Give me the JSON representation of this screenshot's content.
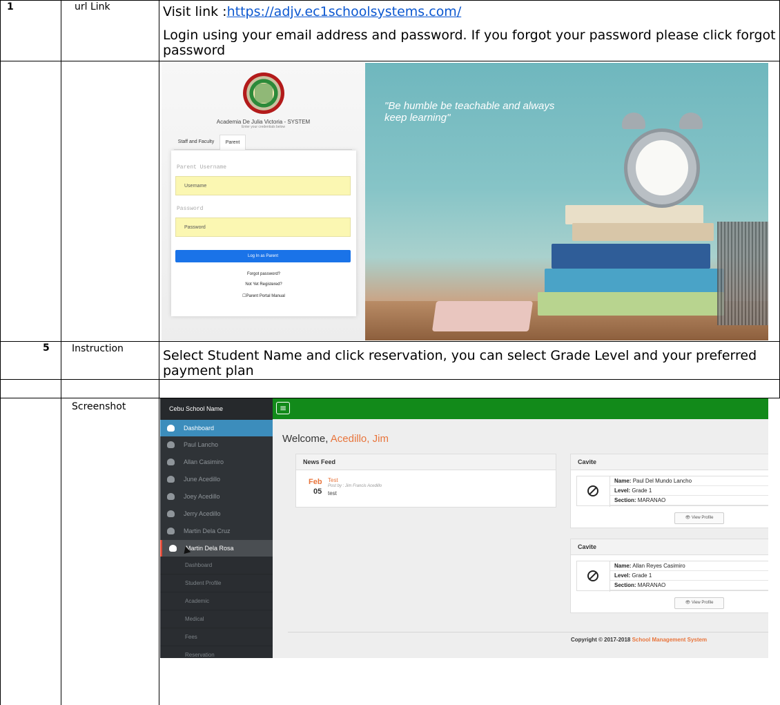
{
  "rows": [
    {
      "number": "1",
      "label": "url Link",
      "text_prefix": "Visit link :",
      "link": "https://adjv.ec1schoolsystems.com/",
      "text": "Login using your email address and password. If you forgot your password please click forgot password"
    },
    {
      "number": "5",
      "label": "Instruction",
      "text": "Select Student Name and click reservation, you can select Grade Level and your preferred payment plan"
    },
    {
      "label": "Screenshot"
    }
  ],
  "login_screenshot": {
    "school_name": "Academia De Julia Victoria - SYSTEM",
    "subtitle": "Enter your credentials below",
    "tabs": [
      "Staff and Faculty",
      "Parent"
    ],
    "active_tab": "Parent",
    "username_label": "Parent Username",
    "username_placeholder": "Username",
    "password_label": "Password",
    "password_placeholder": "Password",
    "login_button": "Log In as Parent",
    "links": [
      "Forgot password?",
      "Not Yet Registered?",
      "☐Parent Portal Manual"
    ],
    "quote": "\"Be humble be teachable and always keep learning\""
  },
  "dashboard_screenshot": {
    "brand": "Cebu School Name",
    "sidebar_items": [
      "Dashboard",
      "Paul Lancho",
      "Allan Casimiro",
      "June Acedillo",
      "Joey Acedillo",
      "Jerry Acedillo",
      "Martin Dela Cruz",
      "Martin Dela Rosa"
    ],
    "submenu_items": [
      "Dashboard",
      "Student Profile",
      "Academic",
      "Medical",
      "Fees",
      "Reservation"
    ],
    "welcome_prefix": "Welcome, ",
    "welcome_name": "Acedillo, Jim",
    "news_feed": {
      "title": "News Feed",
      "month": "Feb",
      "day": "05",
      "post_title": "Test",
      "posted_by": "Post by : Jim Francis Acedillo",
      "body": "test"
    },
    "students": [
      {
        "campus": "Cavite",
        "name_label": "Name:",
        "name": "Paul Del Mundo Lancho",
        "level_label": "Level:",
        "level": "Grade 1",
        "section_label": "Section:",
        "section": "MARANAO",
        "button": "👁 View Profile"
      },
      {
        "campus": "Cavite",
        "name_label": "Name:",
        "name": "Allan Reyes Casimiro",
        "level_label": "Level:",
        "level": "Grade 1",
        "section_label": "Section:",
        "section": "MARANAO",
        "button": "👁 View Profile"
      }
    ],
    "copyright_prefix": "Copyright © 2017-2018 ",
    "copyright_name": "School Management System"
  },
  "colors": {
    "link": "#0b57d0",
    "accent_orange": "#e8743b",
    "topbar_green": "#128a1a",
    "sidebar_active": "#3c8dbc"
  }
}
